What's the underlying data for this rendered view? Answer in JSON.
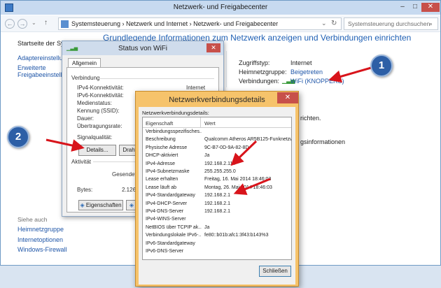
{
  "window": {
    "title": "Netzwerk- und Freigabecenter",
    "minimize": "–",
    "maximize": "□",
    "close": "✕"
  },
  "addressbar": {
    "breadcrumb": "Systemsteuerung  ›  Netzwerk und Internet  ›  Netzwerk- und Freigabecenter",
    "search_placeholder": "Systemsteuerung durchsuchen",
    "refresh": "↻",
    "dropdown": "⌄"
  },
  "sidebar": {
    "items": [
      {
        "label": "Startseite der Systemsteuerung"
      },
      {
        "label": "Adaptereinstellungen ändern"
      },
      {
        "label": "Erweiterte"
      },
      {
        "label": "Freigabeeinstellungen ändern"
      }
    ],
    "see_also": "Siehe auch",
    "see_also_items": [
      {
        "label": "Heimnetzgruppe"
      },
      {
        "label": "Internetoptionen"
      },
      {
        "label": "Windows-Firewall"
      }
    ]
  },
  "main": {
    "heading": "Grundlegende Informationen zum Netzwerk anzeigen und Verbindungen einrichten",
    "access_type_label": "Zugriffstyp:",
    "access_type_value": "Internet",
    "homegroup_label": "Heimnetzgruppe:",
    "homegroup_value": "Beigetreten",
    "connections_label": "Verbindungen:",
    "connections_value": "WiFi (KNOPPERS)",
    "fragment_1": "richten.",
    "fragment_2": "gsinformationen"
  },
  "wifi_dialog": {
    "title": "Status von WiFi",
    "tab": "Allgemein",
    "connection_group": "Verbindung",
    "rows": [
      {
        "label": "IPv4-Konnektivität:",
        "value": "Internet"
      },
      {
        "label": "IPv6-Konnektivität:",
        "value": ""
      },
      {
        "label": "Medienstatus:",
        "value": ""
      },
      {
        "label": "Kennung (SSID):",
        "value": ""
      },
      {
        "label": "Dauer:",
        "value": ""
      },
      {
        "label": "Übertragungsrate:",
        "value": ""
      }
    ],
    "signal_label": "Signalqualität:",
    "details_button": "Details...",
    "wireless_button": "Drahtl",
    "activity_group": "Aktivität",
    "sent_label": "Gesendet",
    "bytes_label": "Bytes:",
    "bytes_value": "2.126",
    "properties_button": "Eigenschaften"
  },
  "details_dialog": {
    "title": "Netzwerkverbindungsdetails",
    "label": "Netzwerkverbindungsdetails:",
    "col_property": "Eigenschaft",
    "col_value": "Wert",
    "rows": [
      {
        "property": "Verbindungsspezifisches...",
        "value": ""
      },
      {
        "property": "Beschreibung",
        "value": "Qualcomm Atheros AR5B125-Funknetzw"
      },
      {
        "property": "Physische Adresse",
        "value": "9C-B7-0D-9A-82-8D"
      },
      {
        "property": "DHCP-aktiviert",
        "value": "Ja"
      },
      {
        "property": "IPv4-Adresse",
        "value": "192.168.2.114"
      },
      {
        "property": "IPv4-Subnetzmaske",
        "value": "255.255.255.0"
      },
      {
        "property": "Lease erhalten",
        "value": "Freitag, 16. Mai 2014 18:46:03"
      },
      {
        "property": "Lease läuft ab",
        "value": "Montag, 26. Mai 2014 18:46:03"
      },
      {
        "property": "IPv4-Standardgateway",
        "value": "192.168.2.1"
      },
      {
        "property": "IPv4-DHCP-Server",
        "value": "192.168.2.1"
      },
      {
        "property": "IPv4-DNS-Server",
        "value": "192.168.2.1"
      },
      {
        "property": "IPv4-WINS-Server",
        "value": ""
      },
      {
        "property": "NetBIOS über TCPIP ak...",
        "value": "Ja"
      },
      {
        "property": "Verbindungslokale IPv6-...",
        "value": "fe80::b01b:afc1:3f43:b143%3"
      },
      {
        "property": "IPv6-Standardgateway",
        "value": ""
      },
      {
        "property": "IPv6-DNS-Server",
        "value": ""
      }
    ],
    "close_button": "Schließen"
  },
  "callouts": {
    "one": "1",
    "two": "2"
  },
  "colors": {
    "arrow": "#d8141b",
    "badge": "#2d5fa6",
    "link": "#1f56a8",
    "dialog_frame": "#f6c36b"
  }
}
